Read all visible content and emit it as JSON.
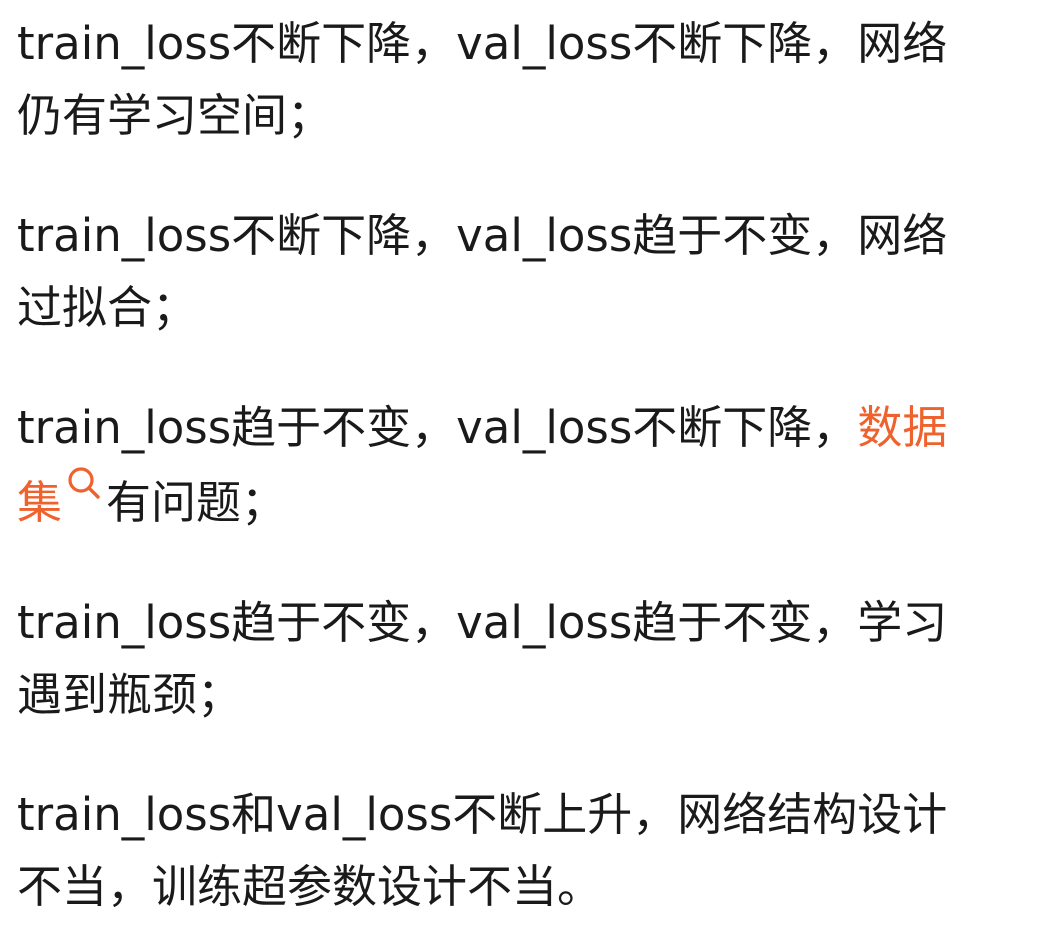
{
  "paragraphs": [
    {
      "text": "train_loss不断下降，val_loss不断下降，网络仍有学习空间；"
    },
    {
      "text": "train_loss不断下降，val_loss趋于不变，网络过拟合；"
    },
    {
      "before": "train_loss趋于不变，val_loss不断下降，",
      "link": "数据集",
      "after": "有问题；"
    },
    {
      "text": "train_loss趋于不变，val_loss趋于不变，学习遇到瓶颈；"
    },
    {
      "text": "train_loss和val_loss不断上升，网络结构设计不当，训练超参数设计不当。"
    }
  ],
  "colors": {
    "text": "#1a1a1a",
    "link": "#f0622d",
    "background": "#ffffff"
  },
  "icons": {
    "search": "search-icon"
  }
}
